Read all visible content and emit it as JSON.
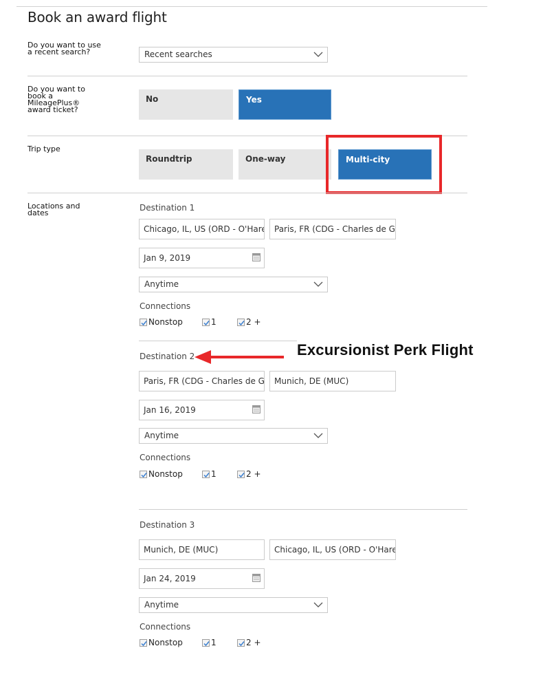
{
  "page": {
    "title": "Book an award flight"
  },
  "recent_search": {
    "question": "Do you want to use a recent search?",
    "select_value": "Recent searches",
    "chevron_icon": "chevron-down-icon"
  },
  "award_ticket": {
    "question": "Do you want to book a MileagePlus® award ticket?",
    "options": [
      {
        "label": "No",
        "selected": false
      },
      {
        "label": "Yes",
        "selected": true
      }
    ]
  },
  "trip_type": {
    "question": "Trip type",
    "options": [
      {
        "label": "Roundtrip",
        "selected": false
      },
      {
        "label": "One-way",
        "selected": false
      },
      {
        "label": "Multi-city",
        "selected": true
      }
    ]
  },
  "locations": {
    "question": "Locations and dates",
    "connections_label": "Connections",
    "destinations": [
      {
        "label": "Destination 1",
        "from": "Chicago, IL, US (ORD - O'Hare)",
        "to": "Paris, FR (CDG - Charles de Ga",
        "date": "Jan 9, 2019",
        "time": "Anytime",
        "connections": [
          {
            "label": "Nonstop",
            "checked": true
          },
          {
            "label": "1",
            "checked": true
          },
          {
            "label": "2 +",
            "checked": true
          }
        ]
      },
      {
        "label": "Destination 2",
        "from": "Paris, FR (CDG - Charles de Ga",
        "to": "Munich, DE (MUC)",
        "date": "Jan 16, 2019",
        "time": "Anytime",
        "connections": [
          {
            "label": "Nonstop",
            "checked": true
          },
          {
            "label": "1",
            "checked": true
          },
          {
            "label": "2 +",
            "checked": true
          }
        ]
      },
      {
        "label": "Destination 3",
        "from": "Munich, DE (MUC)",
        "to": "Chicago, IL, US (ORD - O'Hare)",
        "date": "Jan 24, 2019",
        "time": "Anytime",
        "connections": [
          {
            "label": "Nonstop",
            "checked": true
          },
          {
            "label": "1",
            "checked": true
          },
          {
            "label": "2 +",
            "checked": true
          }
        ]
      }
    ]
  },
  "annotation": {
    "text": "Excursionist Perk Flight",
    "arrow_color": "#e8282a",
    "highlight_color": "#e8282a"
  },
  "colors": {
    "selected_blue": "#2872b7",
    "unselected_gray": "#e6e6e6",
    "checkbox_check": "#3a7fd0"
  }
}
